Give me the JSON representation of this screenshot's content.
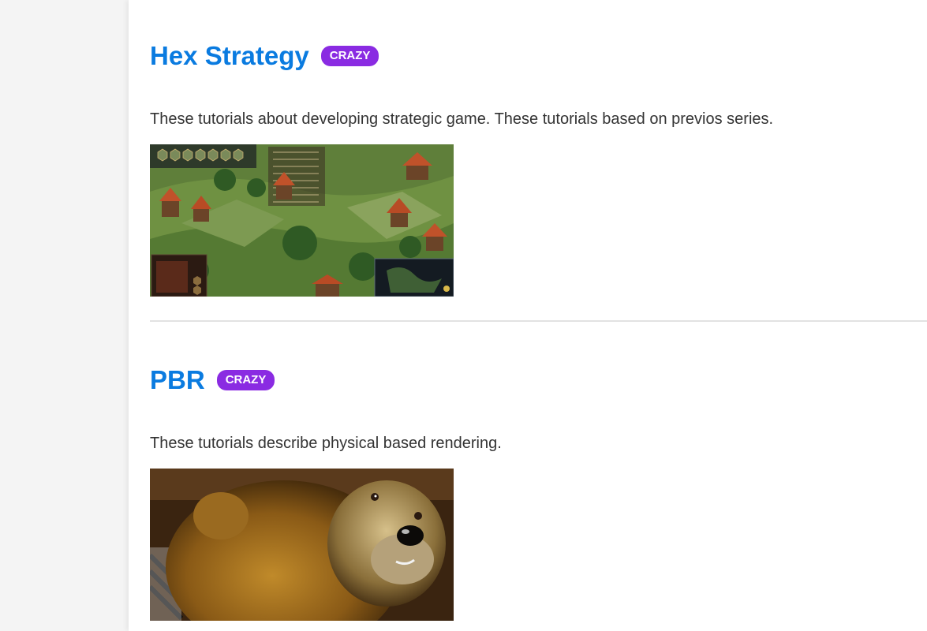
{
  "sections": [
    {
      "title": "Hex Strategy",
      "badge": "CRAZY",
      "description": "These tutorials about developing strategic game. These tutorials based on previos series.",
      "image_name": "hex-strategy-screenshot"
    },
    {
      "title": "PBR",
      "badge": "CRAZY",
      "description": "These tutorials describe physical based rendering.",
      "image_name": "pbr-bear-render"
    }
  ],
  "colors": {
    "title": "#0a7be0",
    "badge": "#8a2be2",
    "text": "#333333",
    "background": "#f4f4f4"
  }
}
